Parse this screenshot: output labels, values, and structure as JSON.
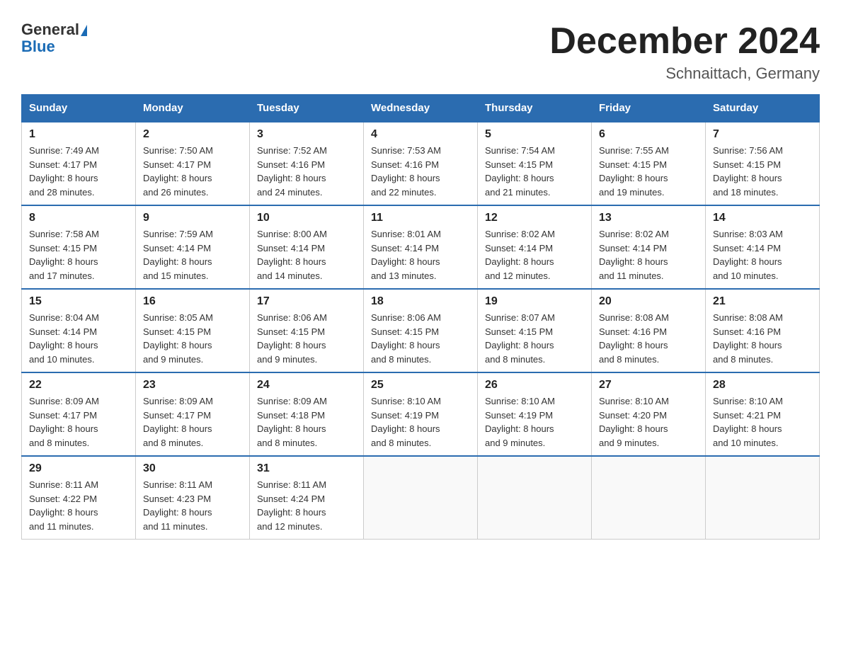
{
  "header": {
    "logo_general": "General",
    "logo_blue": "Blue",
    "month_title": "December 2024",
    "location": "Schnaittach, Germany"
  },
  "days_of_week": [
    "Sunday",
    "Monday",
    "Tuesday",
    "Wednesday",
    "Thursday",
    "Friday",
    "Saturday"
  ],
  "weeks": [
    [
      {
        "day": "1",
        "sunrise": "7:49 AM",
        "sunset": "4:17 PM",
        "daylight": "8 hours and 28 minutes."
      },
      {
        "day": "2",
        "sunrise": "7:50 AM",
        "sunset": "4:17 PM",
        "daylight": "8 hours and 26 minutes."
      },
      {
        "day": "3",
        "sunrise": "7:52 AM",
        "sunset": "4:16 PM",
        "daylight": "8 hours and 24 minutes."
      },
      {
        "day": "4",
        "sunrise": "7:53 AM",
        "sunset": "4:16 PM",
        "daylight": "8 hours and 22 minutes."
      },
      {
        "day": "5",
        "sunrise": "7:54 AM",
        "sunset": "4:15 PM",
        "daylight": "8 hours and 21 minutes."
      },
      {
        "day": "6",
        "sunrise": "7:55 AM",
        "sunset": "4:15 PM",
        "daylight": "8 hours and 19 minutes."
      },
      {
        "day": "7",
        "sunrise": "7:56 AM",
        "sunset": "4:15 PM",
        "daylight": "8 hours and 18 minutes."
      }
    ],
    [
      {
        "day": "8",
        "sunrise": "7:58 AM",
        "sunset": "4:15 PM",
        "daylight": "8 hours and 17 minutes."
      },
      {
        "day": "9",
        "sunrise": "7:59 AM",
        "sunset": "4:14 PM",
        "daylight": "8 hours and 15 minutes."
      },
      {
        "day": "10",
        "sunrise": "8:00 AM",
        "sunset": "4:14 PM",
        "daylight": "8 hours and 14 minutes."
      },
      {
        "day": "11",
        "sunrise": "8:01 AM",
        "sunset": "4:14 PM",
        "daylight": "8 hours and 13 minutes."
      },
      {
        "day": "12",
        "sunrise": "8:02 AM",
        "sunset": "4:14 PM",
        "daylight": "8 hours and 12 minutes."
      },
      {
        "day": "13",
        "sunrise": "8:02 AM",
        "sunset": "4:14 PM",
        "daylight": "8 hours and 11 minutes."
      },
      {
        "day": "14",
        "sunrise": "8:03 AM",
        "sunset": "4:14 PM",
        "daylight": "8 hours and 10 minutes."
      }
    ],
    [
      {
        "day": "15",
        "sunrise": "8:04 AM",
        "sunset": "4:14 PM",
        "daylight": "8 hours and 10 minutes."
      },
      {
        "day": "16",
        "sunrise": "8:05 AM",
        "sunset": "4:15 PM",
        "daylight": "8 hours and 9 minutes."
      },
      {
        "day": "17",
        "sunrise": "8:06 AM",
        "sunset": "4:15 PM",
        "daylight": "8 hours and 9 minutes."
      },
      {
        "day": "18",
        "sunrise": "8:06 AM",
        "sunset": "4:15 PM",
        "daylight": "8 hours and 8 minutes."
      },
      {
        "day": "19",
        "sunrise": "8:07 AM",
        "sunset": "4:15 PM",
        "daylight": "8 hours and 8 minutes."
      },
      {
        "day": "20",
        "sunrise": "8:08 AM",
        "sunset": "4:16 PM",
        "daylight": "8 hours and 8 minutes."
      },
      {
        "day": "21",
        "sunrise": "8:08 AM",
        "sunset": "4:16 PM",
        "daylight": "8 hours and 8 minutes."
      }
    ],
    [
      {
        "day": "22",
        "sunrise": "8:09 AM",
        "sunset": "4:17 PM",
        "daylight": "8 hours and 8 minutes."
      },
      {
        "day": "23",
        "sunrise": "8:09 AM",
        "sunset": "4:17 PM",
        "daylight": "8 hours and 8 minutes."
      },
      {
        "day": "24",
        "sunrise": "8:09 AM",
        "sunset": "4:18 PM",
        "daylight": "8 hours and 8 minutes."
      },
      {
        "day": "25",
        "sunrise": "8:10 AM",
        "sunset": "4:19 PM",
        "daylight": "8 hours and 8 minutes."
      },
      {
        "day": "26",
        "sunrise": "8:10 AM",
        "sunset": "4:19 PM",
        "daylight": "8 hours and 9 minutes."
      },
      {
        "day": "27",
        "sunrise": "8:10 AM",
        "sunset": "4:20 PM",
        "daylight": "8 hours and 9 minutes."
      },
      {
        "day": "28",
        "sunrise": "8:10 AM",
        "sunset": "4:21 PM",
        "daylight": "8 hours and 10 minutes."
      }
    ],
    [
      {
        "day": "29",
        "sunrise": "8:11 AM",
        "sunset": "4:22 PM",
        "daylight": "8 hours and 11 minutes."
      },
      {
        "day": "30",
        "sunrise": "8:11 AM",
        "sunset": "4:23 PM",
        "daylight": "8 hours and 11 minutes."
      },
      {
        "day": "31",
        "sunrise": "8:11 AM",
        "sunset": "4:24 PM",
        "daylight": "8 hours and 12 minutes."
      },
      null,
      null,
      null,
      null
    ]
  ],
  "labels": {
    "sunrise": "Sunrise:",
    "sunset": "Sunset:",
    "daylight": "Daylight:"
  }
}
